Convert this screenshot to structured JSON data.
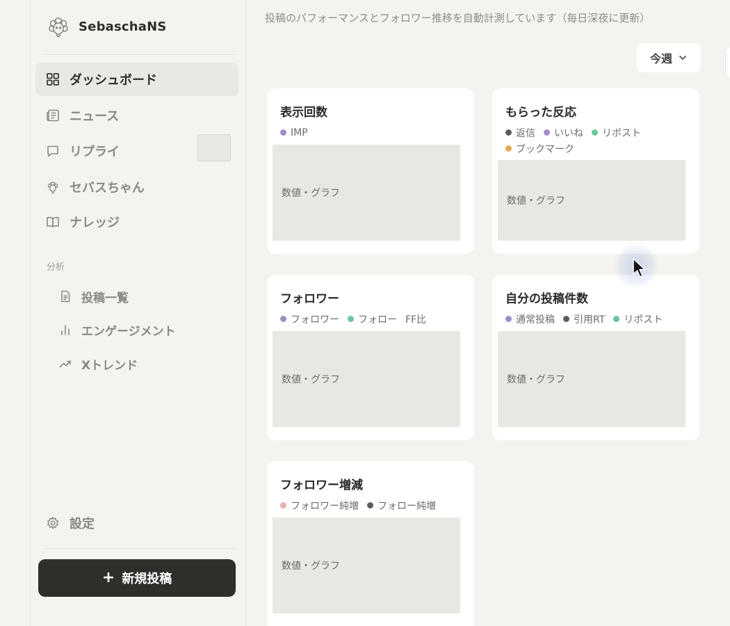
{
  "brand": {
    "name": "SebaschaNS"
  },
  "sidebar": {
    "nav": [
      {
        "label": "ダッシュボード",
        "icon": "dashboard-icon",
        "active": true
      },
      {
        "label": "ニュース",
        "icon": "newspaper-icon"
      },
      {
        "label": "リプライ",
        "icon": "chat-bubble-icon"
      },
      {
        "label": "セバスちゃん",
        "icon": "sebas-mascot-icon"
      },
      {
        "label": "ナレッジ",
        "icon": "book-icon"
      }
    ],
    "section_label": "分析",
    "sub": [
      {
        "label": "投稿一覧",
        "icon": "document-icon"
      },
      {
        "label": "エンゲージメント",
        "icon": "bar-chart-icon"
      },
      {
        "label": "Xトレンド",
        "icon": "trend-up-icon"
      }
    ],
    "settings": {
      "label": "設定",
      "icon": "gear-icon"
    },
    "new_post": {
      "label": "新規投稿",
      "icon": "plus-icon"
    }
  },
  "main": {
    "subtitle": "投稿のパフォーマンスとフォロワー推移を自動計測しています（毎日深夜に更新）",
    "period": {
      "label": "今週",
      "icon": "chevron-down-icon"
    },
    "cards": [
      {
        "title": "表示回数",
        "legend": [
          {
            "label": "IMP",
            "color": "#9f8fc4"
          }
        ],
        "placeholder": "数値・グラフ"
      },
      {
        "title": "もらった反応",
        "legend": [
          {
            "label": "返信",
            "color": "#5d5c58"
          },
          {
            "label": "いいね",
            "color": "#9f8fc4"
          },
          {
            "label": "リポスト",
            "color": "#6cc59e"
          },
          {
            "label": "ブックマーク",
            "color": "#e0ad4f"
          }
        ],
        "placeholder": "数値・グラフ"
      },
      {
        "title": "フォロワー",
        "legend": [
          {
            "label": "フォロワー",
            "color": "#9f8fc4"
          },
          {
            "label": "フォロー",
            "color": "#6cc59e"
          }
        ],
        "extra_label": "FF比",
        "placeholder": "数値・グラフ"
      },
      {
        "title": "自分の投稿件数",
        "legend": [
          {
            "label": "通常投稿",
            "color": "#9f8fc4"
          },
          {
            "label": "引用RT",
            "color": "#5d5c58"
          },
          {
            "label": "リポスト",
            "color": "#6cc59e"
          }
        ],
        "placeholder": "数値・グラフ"
      },
      {
        "title": "フォロワー増減",
        "legend": [
          {
            "label": "フォロワー純増",
            "color": "#e8aeb0"
          },
          {
            "label": "フォロー純増",
            "color": "#5d5c58"
          }
        ],
        "placeholder": "数値・グラフ"
      }
    ]
  }
}
